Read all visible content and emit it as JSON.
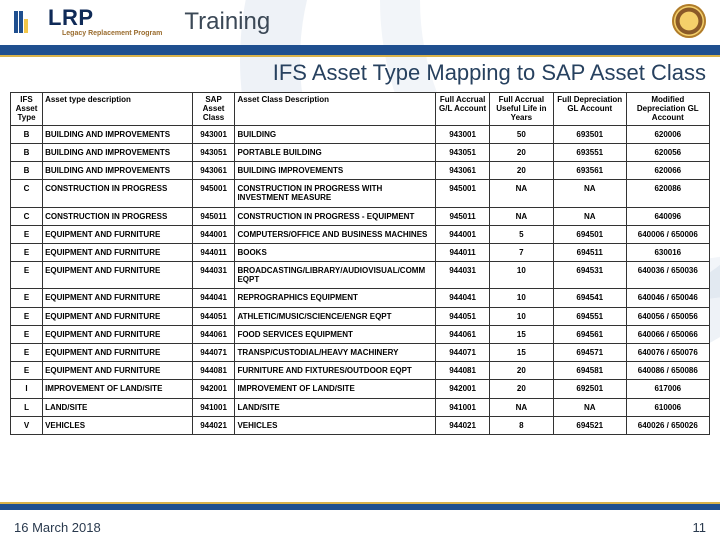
{
  "header": {
    "logo_text": "LRP",
    "logo_sub": "Legacy Replacement Program",
    "section": "Training",
    "page_title": "IFS Asset Type Mapping to SAP Asset Class"
  },
  "table": {
    "headers": [
      "IFS Asset Type",
      "Asset type description",
      "SAP Asset Class",
      "Asset Class Description",
      "Full Accrual G/L Account",
      "Full Accrual Useful Life in Years",
      "Full Depreciation GL Account",
      "Modified Depreciation GL Account"
    ],
    "rows": [
      {
        "t": "B",
        "td": "BUILDING AND IMPROVEMENTS",
        "c": "943001",
        "cd": "BUILDING",
        "gl": "943001",
        "life": "50",
        "fd": "693501",
        "md": "620006"
      },
      {
        "t": "B",
        "td": "BUILDING AND IMPROVEMENTS",
        "c": "943051",
        "cd": "PORTABLE BUILDING",
        "gl": "943051",
        "life": "20",
        "fd": "693551",
        "md": "620056"
      },
      {
        "t": "B",
        "td": "BUILDING AND IMPROVEMENTS",
        "c": "943061",
        "cd": "BUILDING IMPROVEMENTS",
        "gl": "943061",
        "life": "20",
        "fd": "693561",
        "md": "620066"
      },
      {
        "t": "C",
        "td": "CONSTRUCTION IN PROGRESS",
        "c": "945001",
        "cd": "CONSTRUCTION IN PROGRESS WITH INVESTMENT MEASURE",
        "gl": "945001",
        "life": "NA",
        "fd": "NA",
        "md": "620086"
      },
      {
        "t": "C",
        "td": "CONSTRUCTION IN PROGRESS",
        "c": "945011",
        "cd": "CONSTRUCTION IN PROGRESS - EQUIPMENT",
        "gl": "945011",
        "life": "NA",
        "fd": "NA",
        "md": "640096"
      },
      {
        "t": "E",
        "td": "EQUIPMENT AND FURNITURE",
        "c": "944001",
        "cd": "COMPUTERS/OFFICE AND BUSINESS MACHINES",
        "gl": "944001",
        "life": "5",
        "fd": "694501",
        "md": "640006 / 650006"
      },
      {
        "t": "E",
        "td": "EQUIPMENT AND FURNITURE",
        "c": "944011",
        "cd": "BOOKS",
        "gl": "944011",
        "life": "7",
        "fd": "694511",
        "md": "630016"
      },
      {
        "t": "E",
        "td": "EQUIPMENT AND FURNITURE",
        "c": "944031",
        "cd": "BROADCASTING/LIBRARY/AUDIOVISUAL/COMM EQPT",
        "gl": "944031",
        "life": "10",
        "fd": "694531",
        "md": "640036 / 650036"
      },
      {
        "t": "E",
        "td": "EQUIPMENT AND FURNITURE",
        "c": "944041",
        "cd": "REPROGRAPHICS EQUIPMENT",
        "gl": "944041",
        "life": "10",
        "fd": "694541",
        "md": "640046 / 650046"
      },
      {
        "t": "E",
        "td": "EQUIPMENT AND FURNITURE",
        "c": "944051",
        "cd": "ATHLETIC/MUSIC/SCIENCE/ENGR EQPT",
        "gl": "944051",
        "life": "10",
        "fd": "694551",
        "md": "640056 / 650056"
      },
      {
        "t": "E",
        "td": "EQUIPMENT AND FURNITURE",
        "c": "944061",
        "cd": "FOOD SERVICES EQUIPMENT",
        "gl": "944061",
        "life": "15",
        "fd": "694561",
        "md": "640066 / 650066"
      },
      {
        "t": "E",
        "td": "EQUIPMENT AND FURNITURE",
        "c": "944071",
        "cd": "TRANSP/CUSTODIAL/HEAVY MACHINERY",
        "gl": "944071",
        "life": "15",
        "fd": "694571",
        "md": "640076 / 650076"
      },
      {
        "t": "E",
        "td": "EQUIPMENT AND FURNITURE",
        "c": "944081",
        "cd": "FURNITURE AND FIXTURES/OUTDOOR EQPT",
        "gl": "944081",
        "life": "20",
        "fd": "694581",
        "md": "640086 / 650086"
      },
      {
        "t": "I",
        "td": "IMPROVEMENT OF LAND/SITE",
        "c": "942001",
        "cd": "IMPROVEMENT OF LAND/SITE",
        "gl": "942001",
        "life": "20",
        "fd": "692501",
        "md": "617006"
      },
      {
        "t": "L",
        "td": "LAND/SITE",
        "c": "941001",
        "cd": "LAND/SITE",
        "gl": "941001",
        "life": "NA",
        "fd": "NA",
        "md": "610006"
      },
      {
        "t": "V",
        "td": "VEHICLES",
        "c": "944021",
        "cd": "VEHICLES",
        "gl": "944021",
        "life": "8",
        "fd": "694521",
        "md": "640026 / 650026"
      }
    ]
  },
  "footer": {
    "date": "16 March 2018",
    "page": "11"
  }
}
